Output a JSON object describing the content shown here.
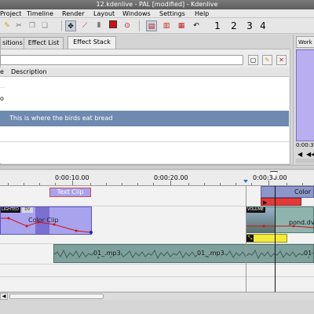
{
  "window": {
    "title": "12.kdenlive - PAL [modified] - Kdenlive"
  },
  "menu": [
    "Project",
    "Timeline",
    "Render",
    "Layout",
    "Windows",
    "Settings",
    "Help"
  ],
  "toolbar": {
    "zoom_numbers": [
      "1",
      "2",
      "3",
      "4"
    ]
  },
  "tabs": [
    "sitions",
    "Effect List",
    "Effect Stack"
  ],
  "effect_list": {
    "columns": [
      "e",
      "Description"
    ],
    "row_partial_1": "...",
    "row_partial_2": "o",
    "selected_description": "This is where the birds eat bread"
  },
  "monitor": {
    "tab_label": "Work",
    "timecode": "0:00:3"
  },
  "timeline": {
    "ruler_labels": [
      "0:00:10.00",
      "0:00:20.00",
      "0:00:30.00"
    ],
    "clips": {
      "text_clip": "Text Clip",
      "color_clip": "Color Clip",
      "color_clip_right": "Color",
      "lighted_badge": "LIGHTED",
      "dv_badge": "DV",
      "volume_badge": "VOLUME",
      "pond_clip": "pond.dv",
      "audio_clip_1": "01_.mp3",
      "audio_clip_2": "01_.mp3",
      "audio_clip_3": "01"
    }
  },
  "colors": {
    "clip_purple": "#a9a3ee",
    "clip_purple_border": "#5a52c0",
    "audio_teal": "#7fa19c",
    "selection_blue": "#6f8ab0",
    "transition_red": "#e23a3a",
    "transition_yellow": "#f4ea3a"
  }
}
